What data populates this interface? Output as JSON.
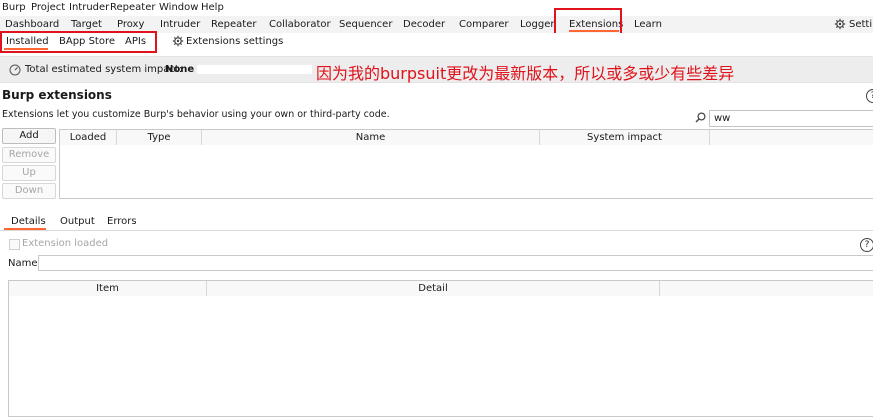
{
  "menu": [
    "Burp",
    "Project",
    "Intruder",
    "Repeater",
    "Window",
    "Help"
  ],
  "tabs": [
    "Dashboard",
    "Target",
    "Proxy",
    "Intruder",
    "Repeater",
    "Collaborator",
    "Sequencer",
    "Decoder",
    "Comparer",
    "Logger",
    "Extensions",
    "Learn"
  ],
  "settings_label": "Settings",
  "subtabs": [
    "Installed",
    "BApp Store",
    "APIs"
  ],
  "extensions_settings": "Extensions settings",
  "impact": {
    "label": "Total estimated system impact:",
    "value": "None"
  },
  "annotation": "因为我的burpsuit更改为最新版本，所以或多或少有些差异",
  "section": {
    "title": "Burp extensions",
    "desc": "Extensions let you customize Burp's behavior using your own or third-party code."
  },
  "search_value": "ww",
  "buttons": [
    "Add",
    "Remove",
    "Up",
    "Down"
  ],
  "ext_table_headers": [
    "Loaded",
    "Type",
    "Name",
    "System impact"
  ],
  "details_tabs": [
    "Details",
    "Output",
    "Errors"
  ],
  "extension_loaded": "Extension loaded",
  "name_label": "Name:",
  "detail_table_headers": [
    "Item",
    "Detail"
  ],
  "colors": {
    "accent": "#ff6633",
    "annotation_red": "#e0121b"
  }
}
